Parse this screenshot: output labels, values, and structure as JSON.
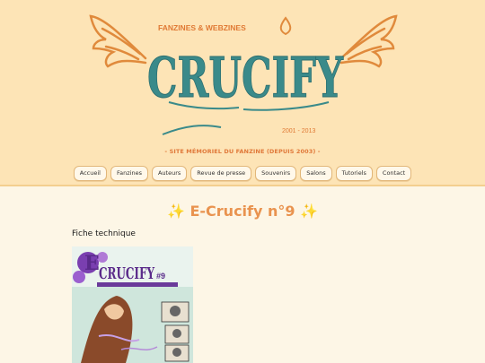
{
  "logo": {
    "title": "CRUCIFY",
    "subtitle": "FANZINES & WEBZINES",
    "years": "2001 - 2013"
  },
  "tagline": "- SITE MÉMORIEL DU FANZINE (DEPUIS 2003) -",
  "nav": {
    "items": [
      "Accueil",
      "Fanzines",
      "Auteurs",
      "Revue de presse",
      "Souvenirs",
      "Salons",
      "Tutoriels",
      "Contact"
    ]
  },
  "page": {
    "title": "✨ E-Crucify n°9 ✨",
    "section_heading": "Fiche technique"
  },
  "cover": {
    "title": "CRUCIFY",
    "prefix": "E",
    "issue": "#9"
  },
  "colors": {
    "header_bg": "#fde4b6",
    "page_bg": "#fdf6e6",
    "logo_teal": "#3a8a8a",
    "accent_orange": "#e0793a"
  }
}
